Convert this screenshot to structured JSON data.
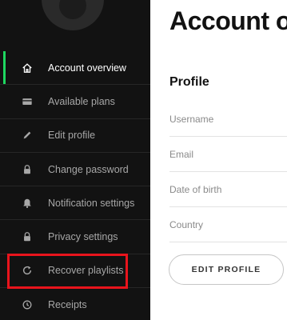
{
  "sidebar": {
    "items": [
      {
        "label": "Account overview",
        "icon": "home-icon",
        "active": true
      },
      {
        "label": "Available plans",
        "icon": "credit-card-icon",
        "active": false
      },
      {
        "label": "Edit profile",
        "icon": "pencil-icon",
        "active": false
      },
      {
        "label": "Change password",
        "icon": "lock-icon",
        "active": false
      },
      {
        "label": "Notification settings",
        "icon": "bell-icon",
        "active": false
      },
      {
        "label": "Privacy settings",
        "icon": "lock-icon",
        "active": false
      },
      {
        "label": "Recover playlists",
        "icon": "refresh-icon",
        "active": false,
        "highlighted": true
      },
      {
        "label": "Receipts",
        "icon": "clock-icon",
        "active": false
      }
    ]
  },
  "main": {
    "title": "Account o",
    "profile": {
      "section_title": "Profile",
      "fields": [
        "Username",
        "Email",
        "Date of birth",
        "Country"
      ],
      "edit_button": "EDIT PROFILE"
    }
  },
  "colors": {
    "sidebar_bg": "#121212",
    "active_indicator": "#1ed760",
    "highlight_border": "#e8141c"
  }
}
